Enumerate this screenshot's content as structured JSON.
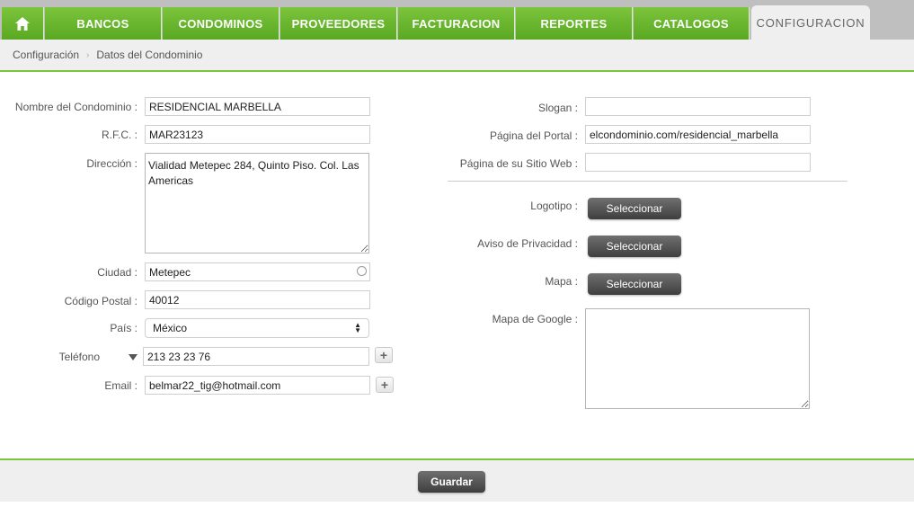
{
  "nav": {
    "items": [
      {
        "label": "BANCOS"
      },
      {
        "label": "CONDOMINOS"
      },
      {
        "label": "PROVEEDORES"
      },
      {
        "label": "FACTURACION"
      },
      {
        "label": "REPORTES"
      },
      {
        "label": "CATALOGOS"
      },
      {
        "label": "CONFIGURACION"
      }
    ],
    "active": "CONFIGURACION",
    "accent_color": "#6ab82e"
  },
  "breadcrumb": {
    "items": [
      "Configuración",
      "Datos del Condominio"
    ]
  },
  "form": {
    "left": {
      "nombre": {
        "label": "Nombre del Condominio :",
        "value": "RESIDENCIAL MARBELLA"
      },
      "rfc": {
        "label": "R.F.C. :",
        "value": "MAR23123"
      },
      "direccion": {
        "label": "Dirección :",
        "value": "Vialidad Metepec 284, Quinto Piso. Col. Las Americas"
      },
      "ciudad": {
        "label": "Ciudad :",
        "value": "Metepec"
      },
      "cp": {
        "label": "Código Postal :",
        "value": "40012"
      },
      "pais": {
        "label": "País :",
        "value": "México"
      },
      "telefono": {
        "label": "Teléfono",
        "value": "213 23 23 76",
        "add_label": "+"
      },
      "email": {
        "label": "Email :",
        "value": "belmar22_tig@hotmail.com",
        "add_label": "+"
      }
    },
    "right": {
      "slogan": {
        "label": "Slogan :",
        "value": ""
      },
      "portal": {
        "label": "Página del Portal :",
        "value": "elcondominio.com/residencial_marbella"
      },
      "sitio": {
        "label": "Página de su Sitio Web :",
        "value": ""
      },
      "logotipo": {
        "label": "Logotipo :",
        "button": "Seleccionar"
      },
      "aviso": {
        "label": "Aviso de Privacidad :",
        "button": "Seleccionar"
      },
      "mapa": {
        "label": "Mapa :",
        "button": "Seleccionar"
      },
      "google": {
        "label": "Mapa de Google :",
        "value": ""
      }
    }
  },
  "footer": {
    "save_label": "Guardar"
  }
}
